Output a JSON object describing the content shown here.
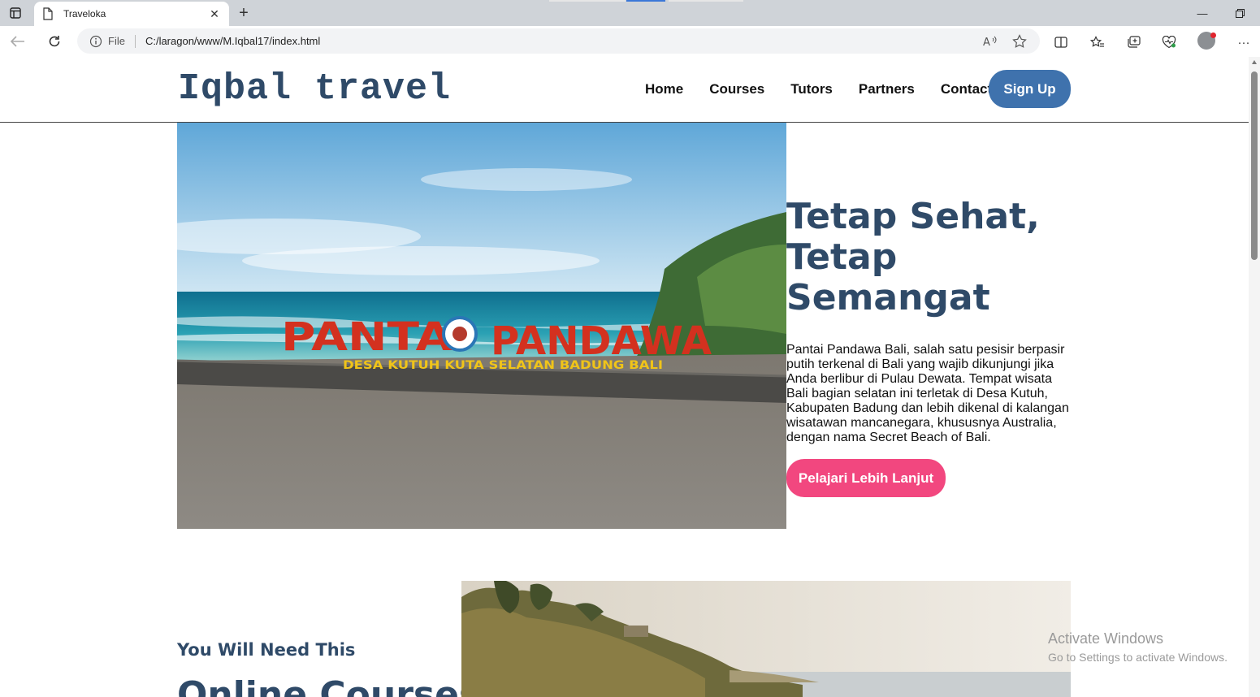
{
  "browser": {
    "tab_title": "Traveloka",
    "address_scheme": "File",
    "address_url": "C:/laragon/www/M.Iqbal17/index.html"
  },
  "site": {
    "logo": "Iqbal travel",
    "nav": [
      "Home",
      "Courses",
      "Tutors",
      "Partners",
      "Contact"
    ],
    "signup_label": "Sign Up"
  },
  "hero": {
    "title": "Tetap Sehat, Tetap Semangat",
    "description": "Pantai Pandawa Bali, salah satu pesisir berpasir putih terkenal di Bali yang wajib dikunjungi jika Anda berlibur di Pulau Dewata. Tempat wisata Bali bagian selatan ini terletak di Desa Kutuh, Kabupaten Badung dan lebih dikenal di kalangan wisatawan mancanegara, khususnya Australia, dengan nama Secret Beach of Bali.",
    "cta_label": "Pelajari Lebih Lanjut",
    "photo_sign_main_left": "PANTAI",
    "photo_sign_main_right": "PANDAWA",
    "photo_sign_sub": "DESA  KUTUH  KUTA  SELATAN  BADUNG  BALI"
  },
  "section2": {
    "subheading": "You Will Need This",
    "title": "Online Courses"
  },
  "watermark": {
    "line1": "Activate Windows",
    "line2": "Go to Settings to activate Windows."
  },
  "colors": {
    "brand_blue": "#2f4a68",
    "signup_blue": "#3f72ad",
    "cta_pink": "#f2477f"
  }
}
